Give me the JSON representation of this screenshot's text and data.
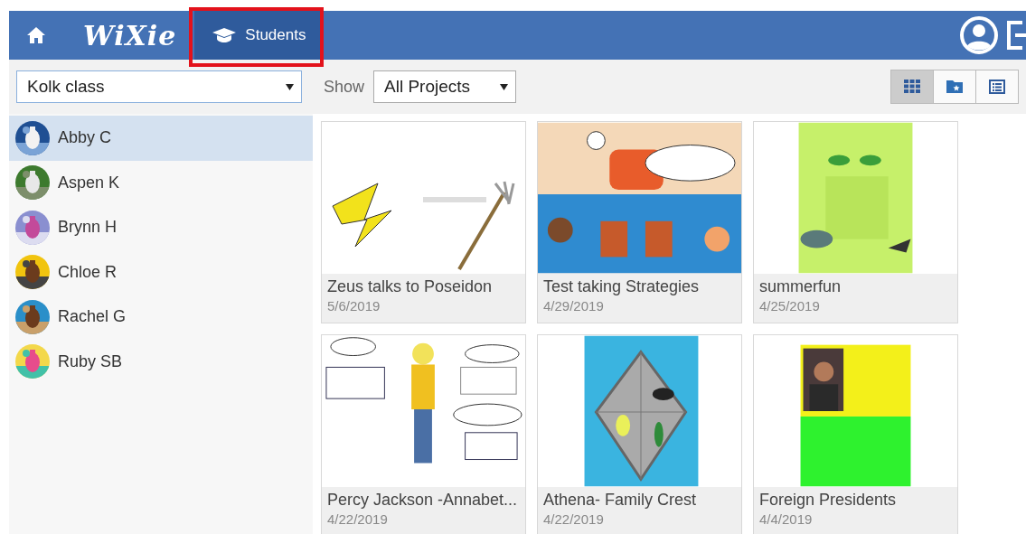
{
  "navbar": {
    "logo": "WiXie",
    "tabs": [
      {
        "label": "Students",
        "selected": true,
        "highlighted": true
      }
    ]
  },
  "toolbar": {
    "class_select": "Kolk class",
    "show_label": "Show",
    "filter_select": "All Projects",
    "views": [
      {
        "kind": "grid",
        "selected": true
      },
      {
        "kind": "folder",
        "selected": false
      },
      {
        "kind": "list",
        "selected": false
      }
    ]
  },
  "students": [
    {
      "name": "Abby C",
      "selected": true
    },
    {
      "name": "Aspen K",
      "selected": false
    },
    {
      "name": "Brynn H",
      "selected": false
    },
    {
      "name": "Chloe R",
      "selected": false
    },
    {
      "name": "Rachel G",
      "selected": false
    },
    {
      "name": "Ruby SB",
      "selected": false
    }
  ],
  "projects": [
    {
      "title": "Zeus talks to Poseidon",
      "date": "5/6/2019"
    },
    {
      "title": "Test taking Strategies",
      "date": "4/29/2019"
    },
    {
      "title": "summerfun",
      "date": "4/25/2019"
    },
    {
      "title": "Percy Jackson -Annabet...",
      "date": "4/22/2019"
    },
    {
      "title": "Athena- Family Crest",
      "date": "4/22/2019"
    },
    {
      "title": "Foreign Presidents",
      "date": "4/4/2019"
    }
  ]
}
